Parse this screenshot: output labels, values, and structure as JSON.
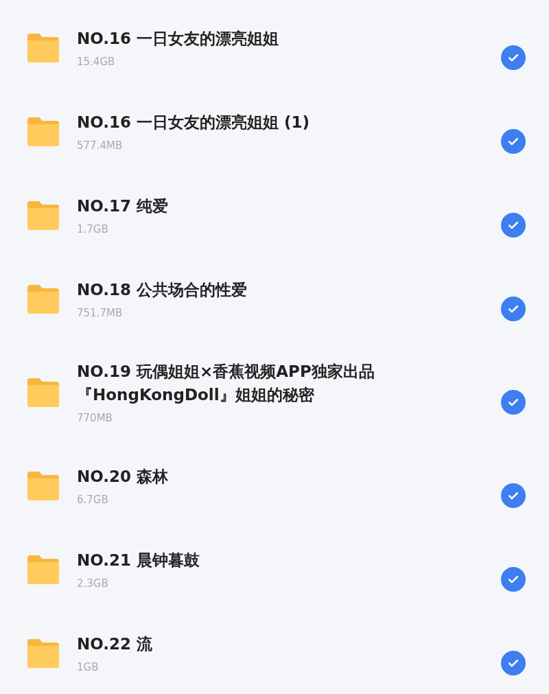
{
  "files": [
    {
      "name": "NO.16 一日女友的漂亮姐姐",
      "size": "15.4GB",
      "checked": true
    },
    {
      "name": "NO.16 一日女友的漂亮姐姐 (1)",
      "size": "577.4MB",
      "checked": true
    },
    {
      "name": "NO.17 纯爱",
      "size": "1.7GB",
      "checked": true
    },
    {
      "name": "NO.18 公共场合的性爱",
      "size": "751.7MB",
      "checked": true
    },
    {
      "name": "NO.19 玩偶姐姐×香蕉视频APP独家出品『HongKongDoll』姐姐的秘密",
      "size": "770MB",
      "checked": true
    },
    {
      "name": "NO.20 森林",
      "size": "6.7GB",
      "checked": true
    },
    {
      "name": "NO.21 晨钟暮鼓",
      "size": "2.3GB",
      "checked": true
    },
    {
      "name": "NO.22 流",
      "size": "1GB",
      "checked": true
    }
  ]
}
